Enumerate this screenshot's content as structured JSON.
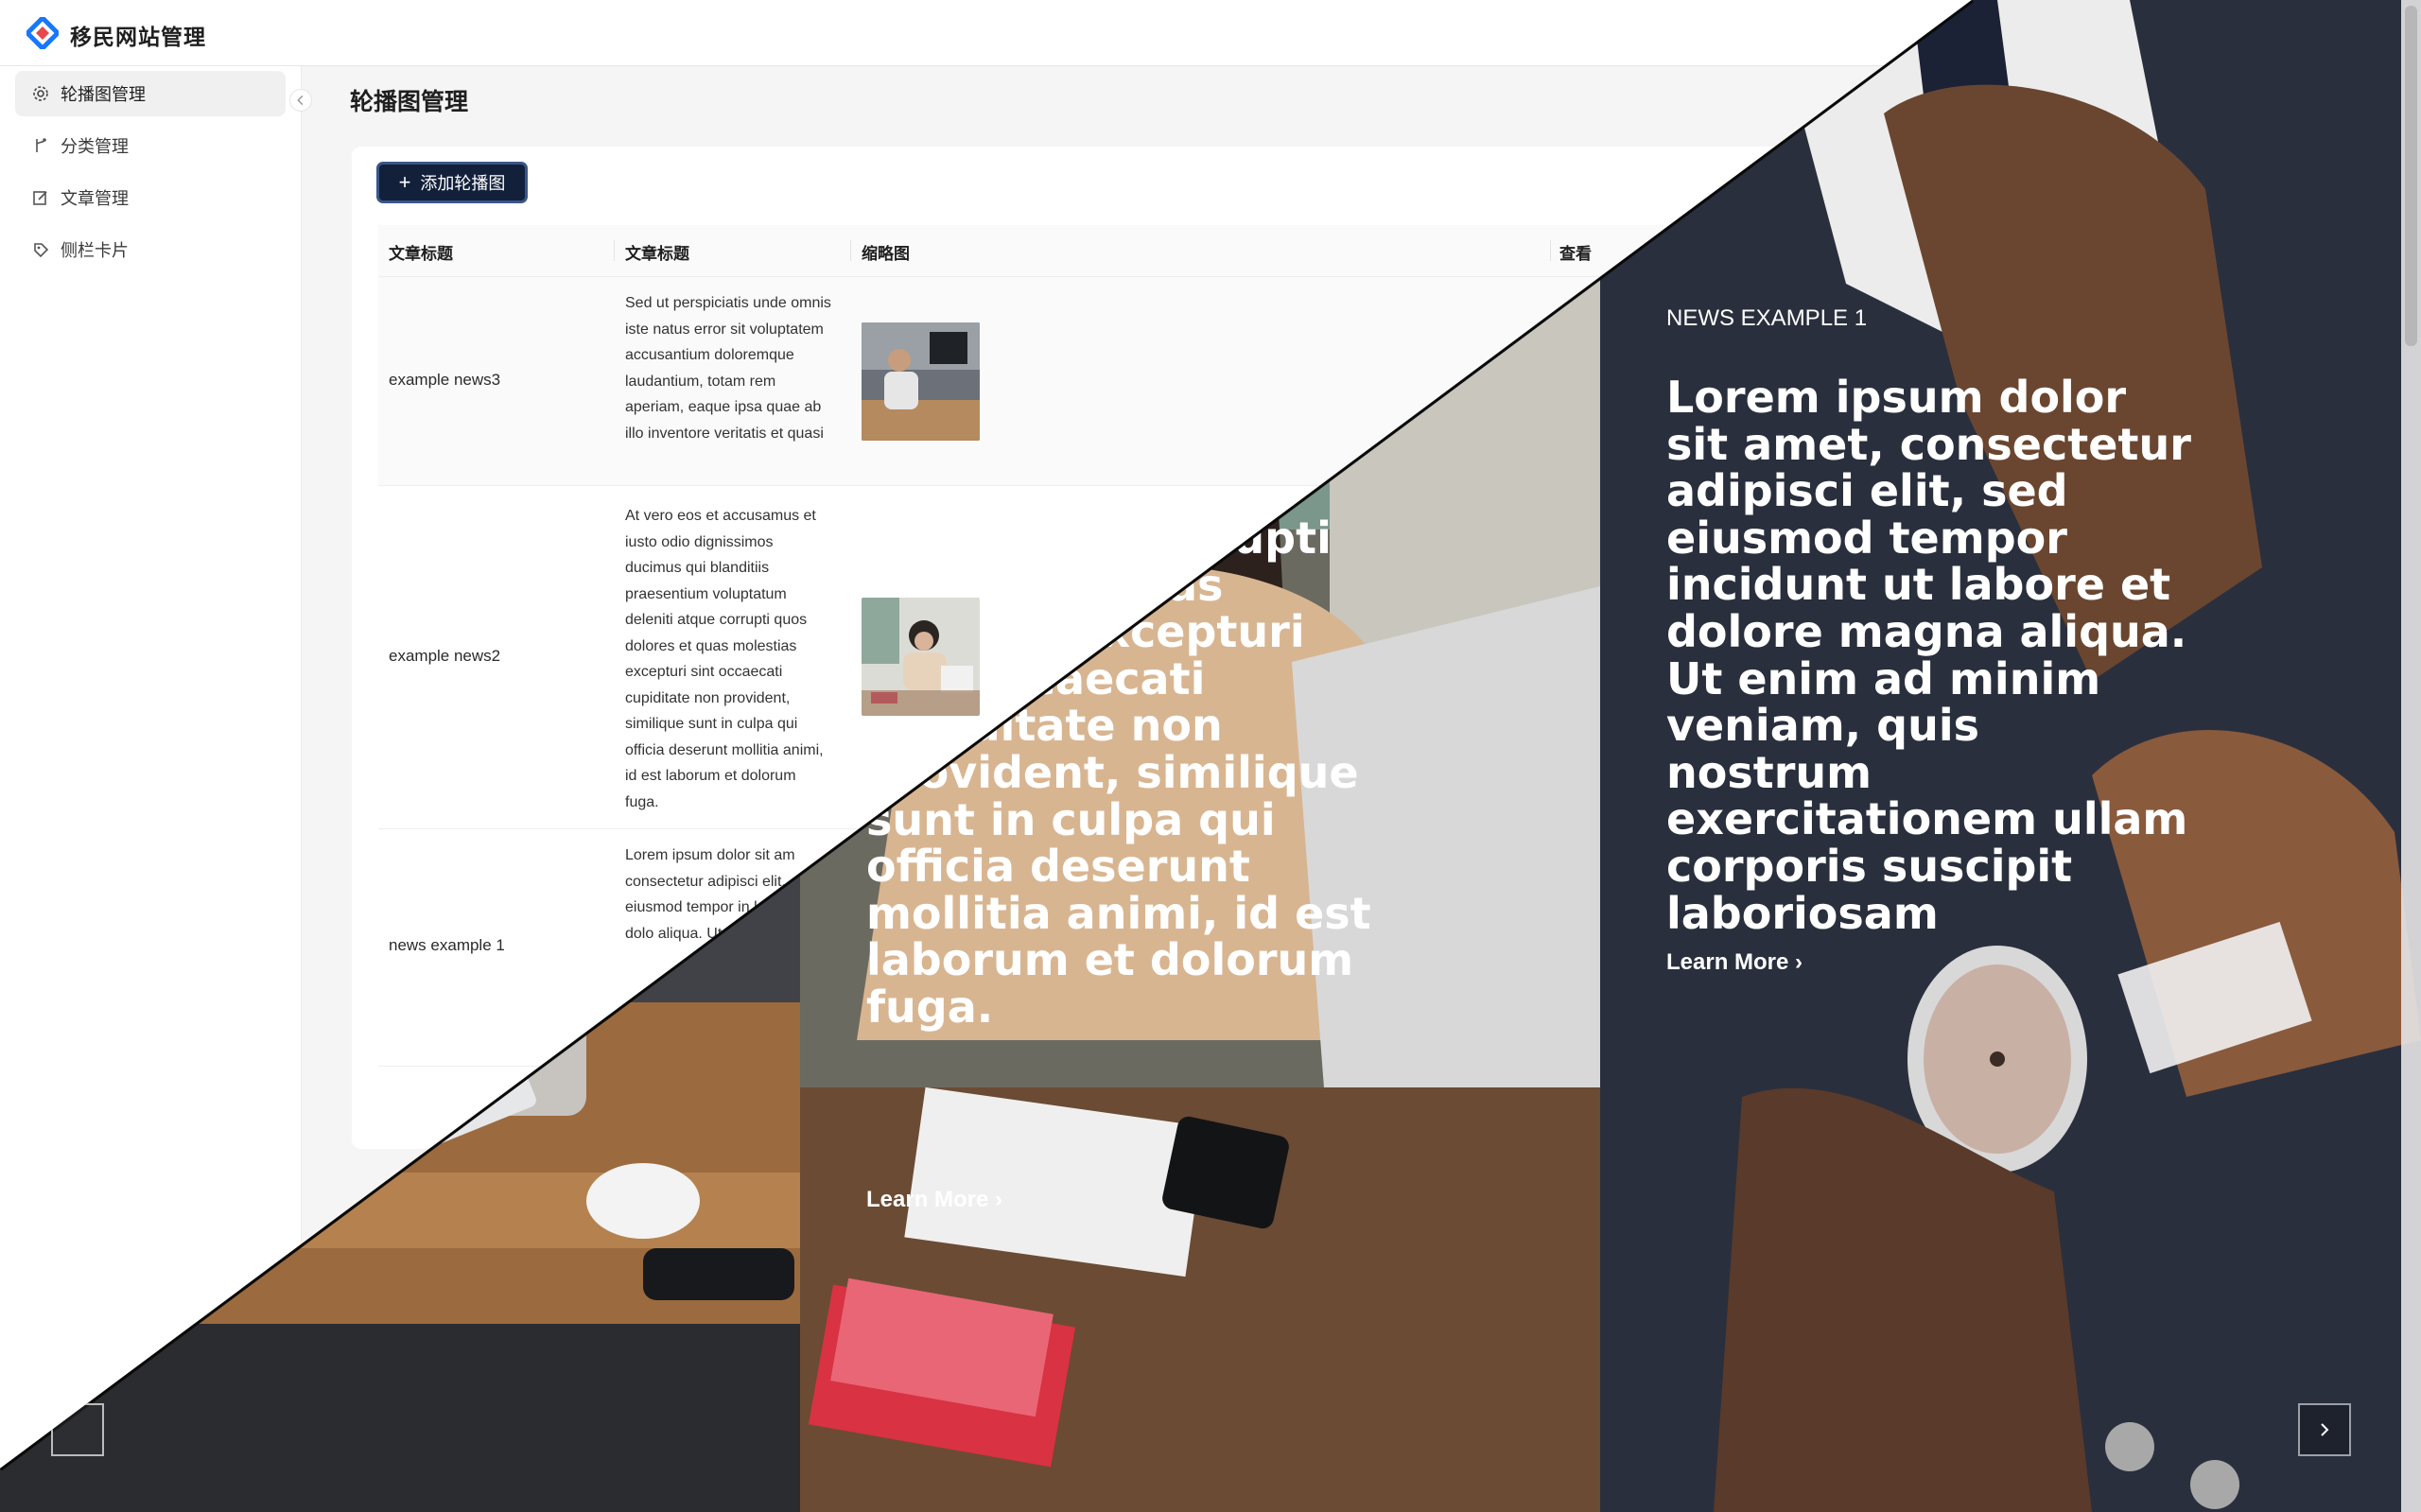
{
  "app": {
    "title": "移民网站管理"
  },
  "sidebar": {
    "items": [
      {
        "label": "轮播图管理",
        "icon": "gear-icon",
        "active": true
      },
      {
        "label": "分类管理",
        "icon": "branch-icon",
        "active": false
      },
      {
        "label": "文章管理",
        "icon": "edit-icon",
        "active": false
      },
      {
        "label": "侧栏卡片",
        "icon": "tag-icon",
        "active": false
      }
    ]
  },
  "header": {
    "search_icon": "search-icon",
    "language_icon": "language-icon"
  },
  "main": {
    "title": "轮播图管理",
    "add_button": "添加轮播图",
    "table": {
      "columns": [
        "文章标题",
        "文章标题",
        "缩略图",
        "查看"
      ],
      "rows": [
        {
          "title": "example news3",
          "desc": "Sed ut perspiciatis unde omnis iste natus error sit voluptatem accusantium doloremque laudantium, totam rem aperiam, eaque ipsa quae ab illo inventore veritatis et quasi"
        },
        {
          "title": "example news2",
          "desc": "At vero eos et accusamus et iusto odio dignissimos ducimus qui blanditiis praesentium voluptatum deleniti atque corrupti quos dolores et quas molestias excepturi sint occaecati cupiditate non provident, similique sunt in culpa qui officia deserunt mollitia animi, id est laborum et dolorum fuga."
        },
        {
          "title": "news example 1",
          "desc": "Lorem ipsum dolor sit am consectetur adipisci elit, eiusmod tempor in labore et dolo aliqua. Ut e venia e"
        }
      ]
    }
  },
  "carousel": {
    "mid": {
      "body": "ntiis deleniti rrupti quos s et quas olestias excepturi sint occaecati cupiditate non provident, similique sunt in culpa qui officia deserunt mollitia animi, id est laborum et dolorum fuga.",
      "more": "Learn More ›"
    },
    "right": {
      "eyebrow": "NEWS EXAMPLE 1",
      "body": "Lorem ipsum dolor sit amet, consectetur adipisci elit, sed eiusmod tempor incidunt ut labore et dolore magna aliqua. Ut enim ad minim veniam, quis nostrum exercitationem ullam corporis suscipit laboriosam",
      "more": "Learn More ›"
    }
  },
  "colors": {
    "primary_button": "#12203a",
    "accent_logo": "#1677ff",
    "accent_logo_2": "#e5484d"
  }
}
